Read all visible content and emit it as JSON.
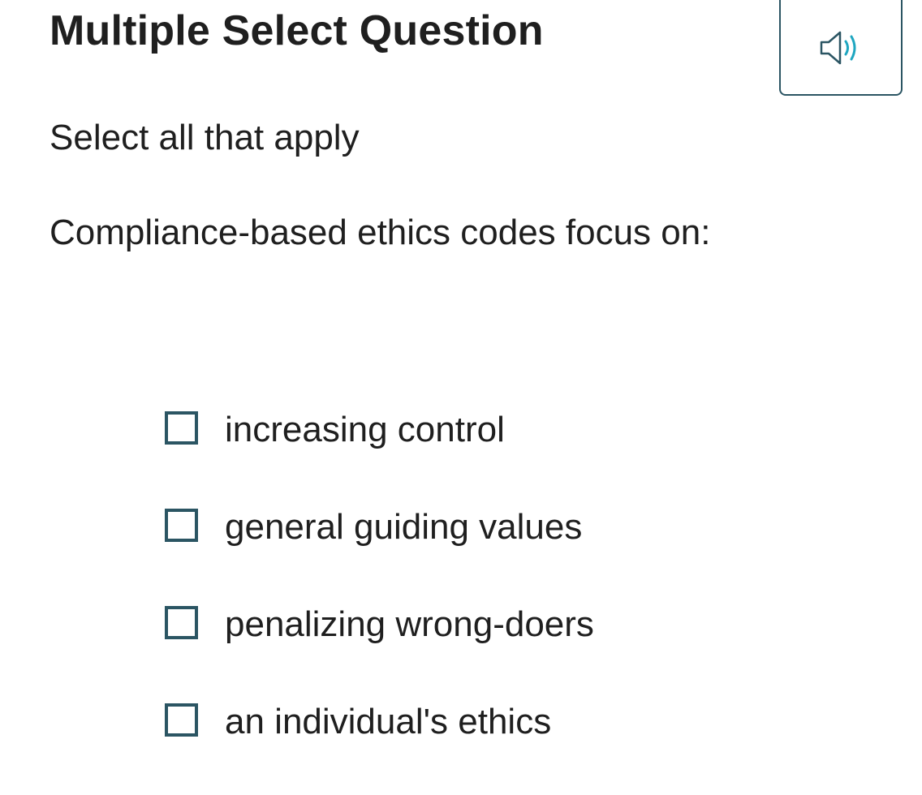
{
  "question": {
    "title": "Multiple Select Question",
    "instruction": "Select all that apply",
    "prompt": "Compliance-based ethics codes focus on:"
  },
  "audio_button": {
    "icon": "speaker-volume-icon",
    "colors": {
      "speaker": "#2b5563",
      "waves": "#1ea6c0",
      "border": "#2b5563"
    }
  },
  "options": [
    {
      "label": "increasing control",
      "checked": false
    },
    {
      "label": "general guiding values",
      "checked": false
    },
    {
      "label": "penalizing wrong-doers",
      "checked": false
    },
    {
      "label": "an individual's ethics",
      "checked": false
    }
  ],
  "colors": {
    "text": "#1f1f1f",
    "checkbox_border": "#2b5563",
    "background": "#ffffff"
  }
}
